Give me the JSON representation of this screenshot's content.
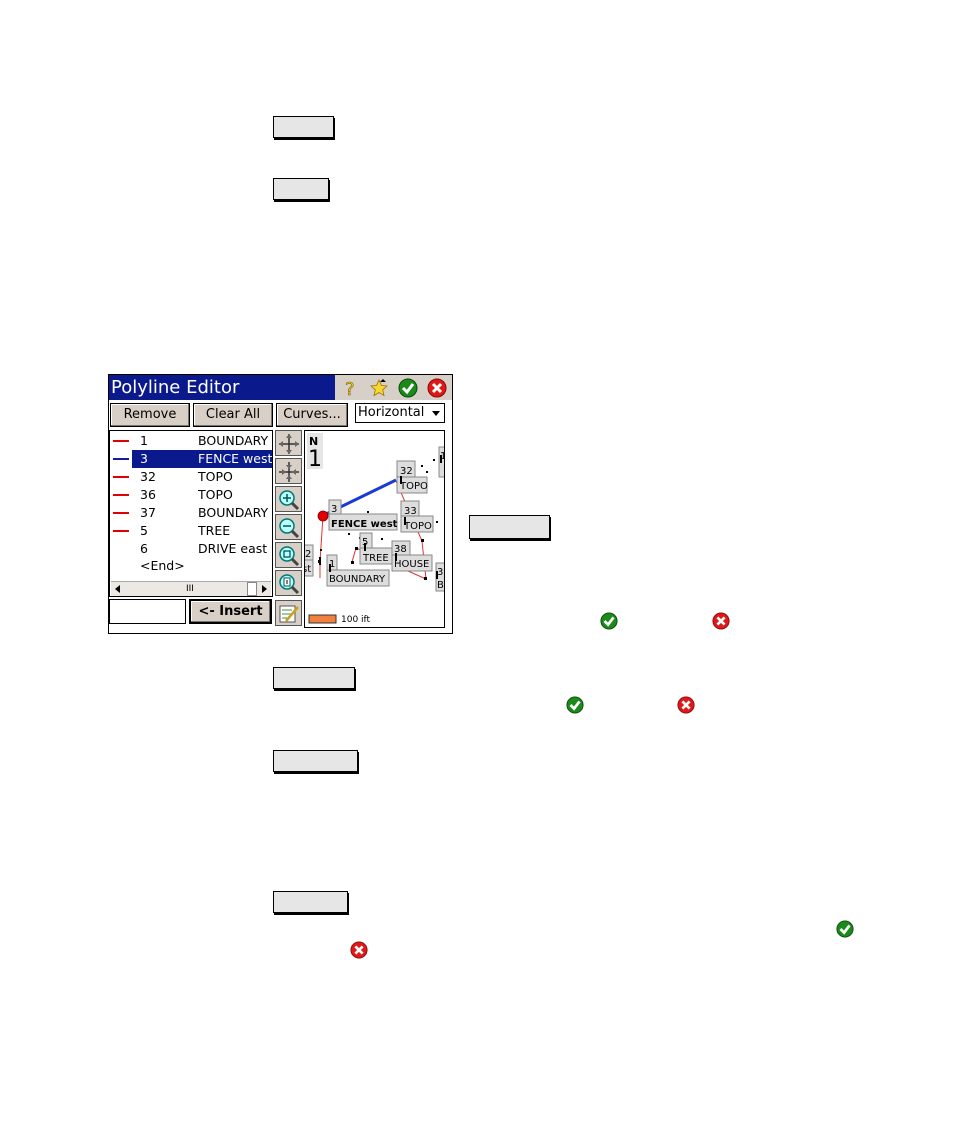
{
  "window": {
    "title": "Polyline Editor",
    "title_icons": [
      "help-icon",
      "favorite-star-icon",
      "ok-check-icon",
      "close-x-icon"
    ]
  },
  "toolbar": {
    "remove_label": "Remove",
    "remove_accel": "R",
    "clear_all_label": "Clear All",
    "clear_accel": "C",
    "curves_label": "Curves...",
    "curves_accel": "u",
    "mode_select": "Horizontal"
  },
  "list": {
    "rows": [
      {
        "number": "1",
        "name": "BOUNDARY",
        "line_color": "#e00000",
        "selected": false
      },
      {
        "number": "3",
        "name": "FENCE west",
        "line_color": "#1a1aa0",
        "selected": true
      },
      {
        "number": "32",
        "name": "TOPO",
        "line_color": "#e00000",
        "selected": false
      },
      {
        "number": "36",
        "name": "TOPO",
        "line_color": "#e00000",
        "selected": false
      },
      {
        "number": "37",
        "name": "BOUNDARY",
        "line_color": "#e00000",
        "selected": false
      },
      {
        "number": "5",
        "name": "TREE",
        "line_color": "#e00000",
        "selected": false
      },
      {
        "number": "6",
        "name": "DRIVE east",
        "line_color": "",
        "selected": false
      }
    ],
    "end_label": "<End>",
    "scroll_grip": "III"
  },
  "insert": {
    "input_value": "",
    "button_label": "<- Insert",
    "button_accel": "I"
  },
  "tools": [
    "zoom-extents-icon",
    "zoom-center-icon",
    "zoom-in-icon",
    "zoom-out-icon",
    "zoom-window-icon",
    "zoom-selection-icon",
    "edit-list-icon"
  ],
  "map": {
    "north_label": "N",
    "north_digit": "1",
    "labels": {
      "l32": "32",
      "topo1": "TOPO",
      "l33": "33",
      "topo2": "TOPO",
      "l3": "3",
      "fence": "FENCE west",
      "l5": "5",
      "tree": "TREE",
      "l38": "38",
      "house": "HOUSE",
      "l2": "2",
      "st": "st",
      "l1": "1",
      "boundary": "BOUNDARY",
      "l3b": "3",
      "b": "B",
      "lright": "1"
    },
    "scale_label": "100 ift",
    "colors": {
      "selected_line": "#1a3ad6",
      "other_lines": "#e83030",
      "start_point": "#e00000",
      "scale_bar": "#f08040"
    }
  }
}
